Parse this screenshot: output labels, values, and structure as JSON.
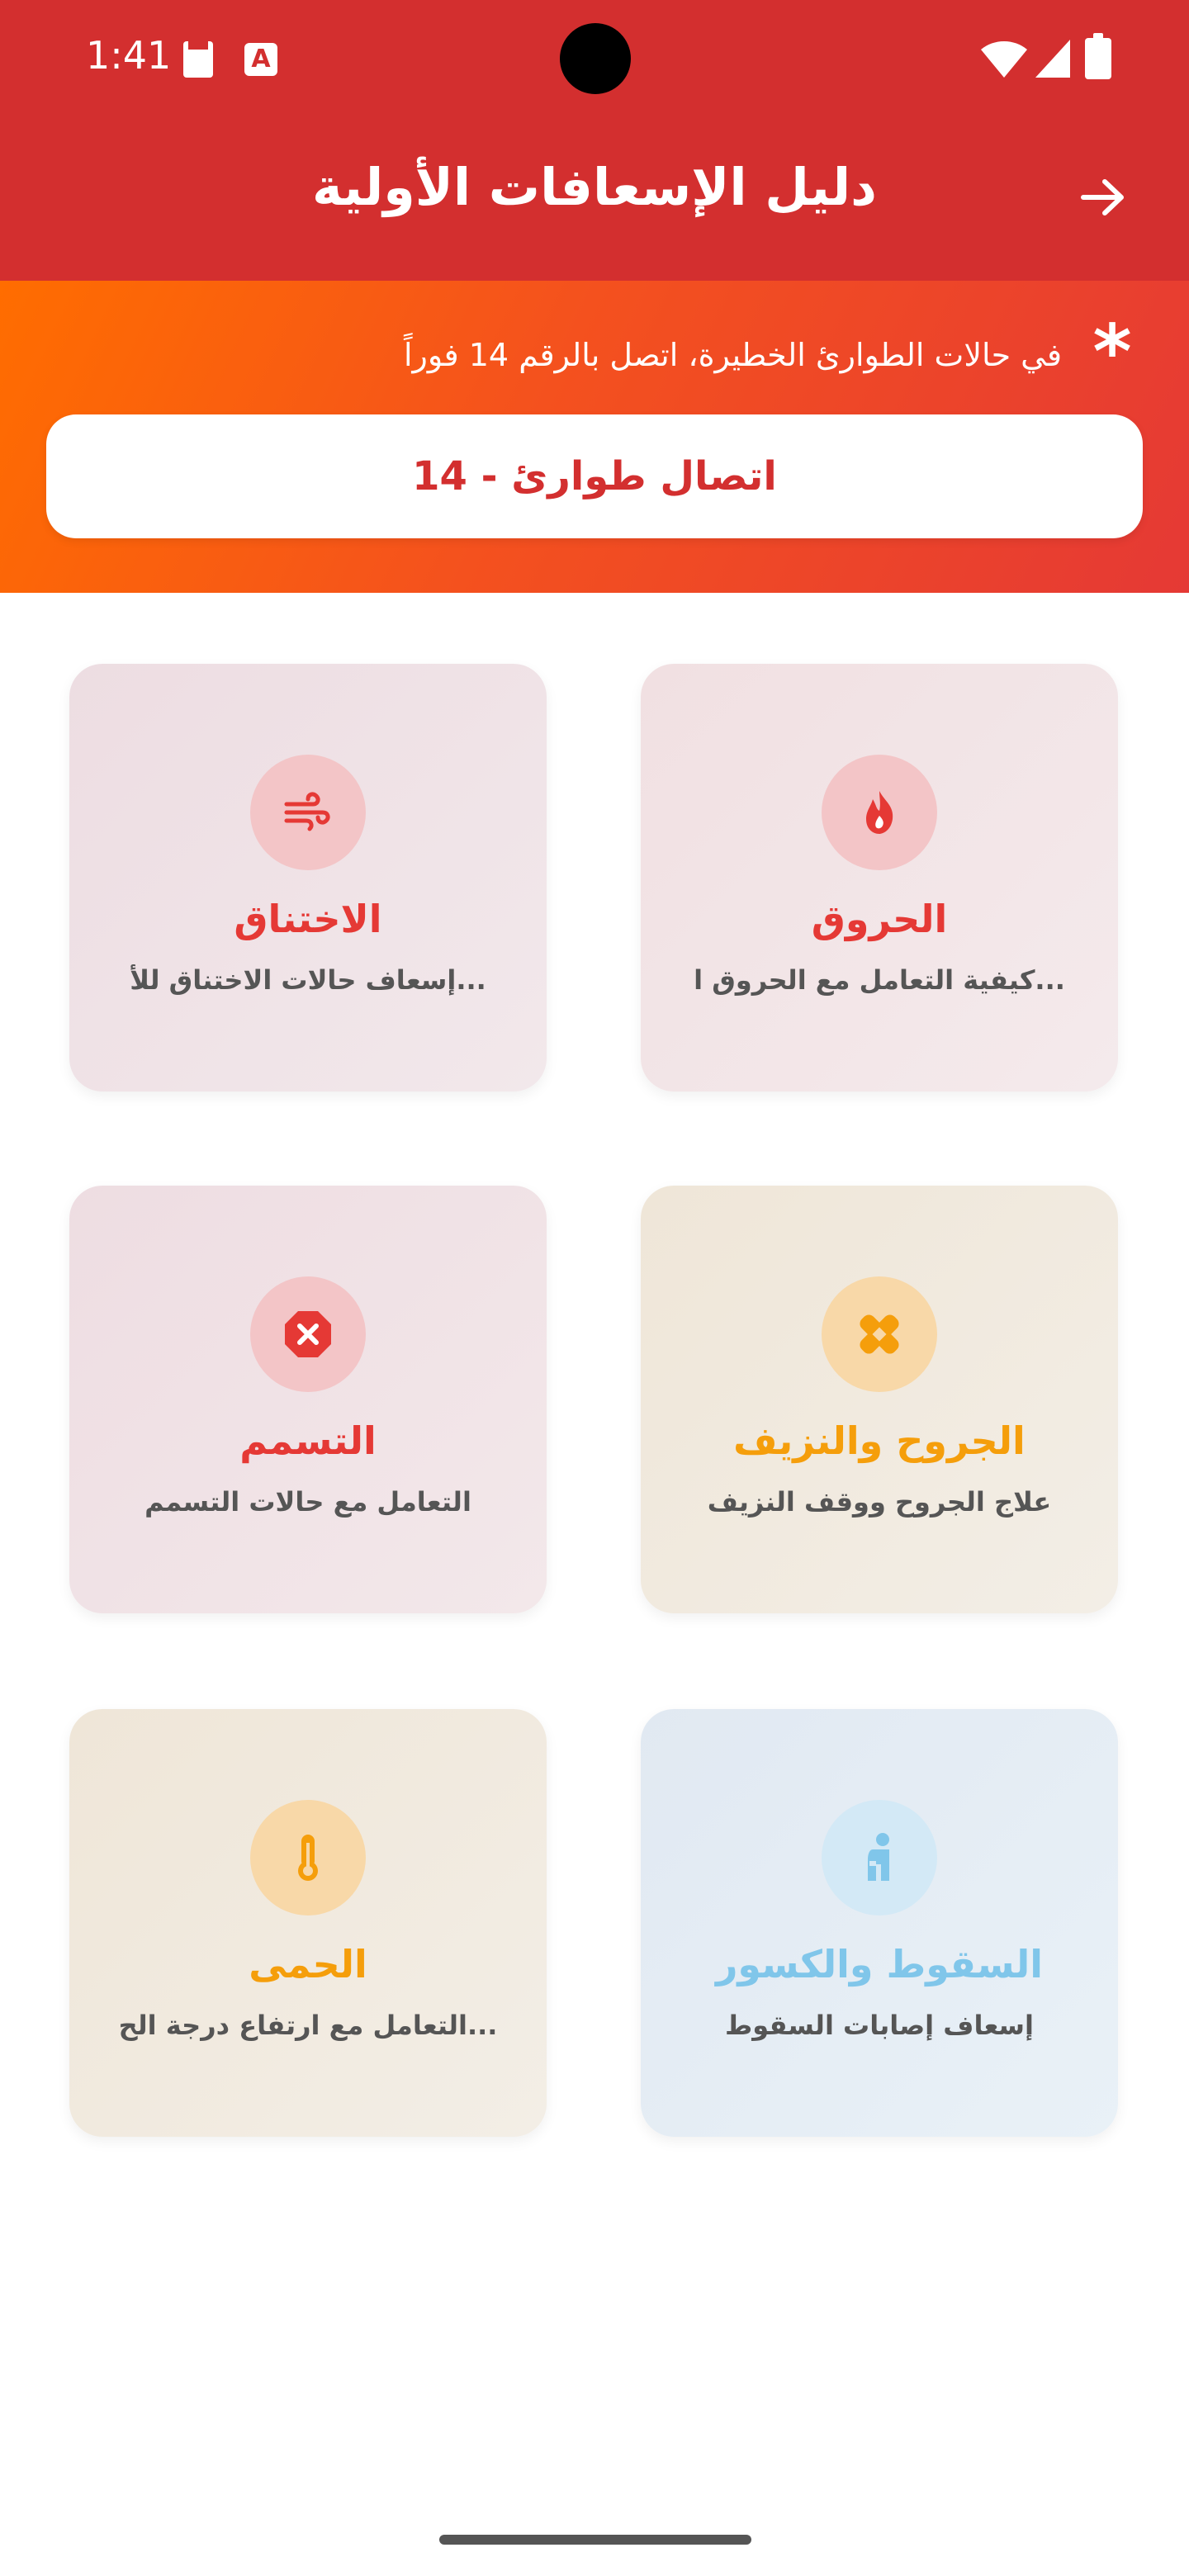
{
  "status_bar": {
    "time": "1:41",
    "icons": [
      "sd-card-icon",
      "a-icon",
      "wifi-icon",
      "signal-icon",
      "battery-icon"
    ]
  },
  "app_bar": {
    "title": "دليل الإسعافات الأولية",
    "back_icon": "arrow-right-icon",
    "color": "#d32f2f"
  },
  "banner": {
    "text": "في حالات الطوارئ الخطيرة، اتصل بالرقم 14 فوراً",
    "icon": "asterisk-icon",
    "button_label": "اتصال طوارئ - 14",
    "gradient_start": "#ff6d00",
    "gradient_end": "#e53935"
  },
  "cards": [
    {
      "title": "الحروق",
      "subtitle": "كيفية التعامل مع الحروق ا...",
      "icon": "fire-icon",
      "color": "#e53935"
    },
    {
      "title": "الاختناق",
      "subtitle": "إسعاف حالات الاختناق للأ...",
      "icon": "wind-icon",
      "color": "#e53935"
    },
    {
      "title": "الجروح والنزيف",
      "subtitle": "علاج الجروح ووقف النزيف",
      "icon": "bandage-icon",
      "color": "#f59e0b"
    },
    {
      "title": "التسمم",
      "subtitle": "التعامل مع حالات التسمم",
      "icon": "poison-icon",
      "color": "#e53935"
    },
    {
      "title": "السقوط والكسور",
      "subtitle": "إسعاف إصابات السقوط",
      "icon": "injured-person-icon",
      "color": "#80c6ea"
    },
    {
      "title": "الحمى",
      "subtitle": "التعامل مع ارتفاع درجة الح...",
      "icon": "thermometer-icon",
      "color": "#f59e0b"
    }
  ]
}
